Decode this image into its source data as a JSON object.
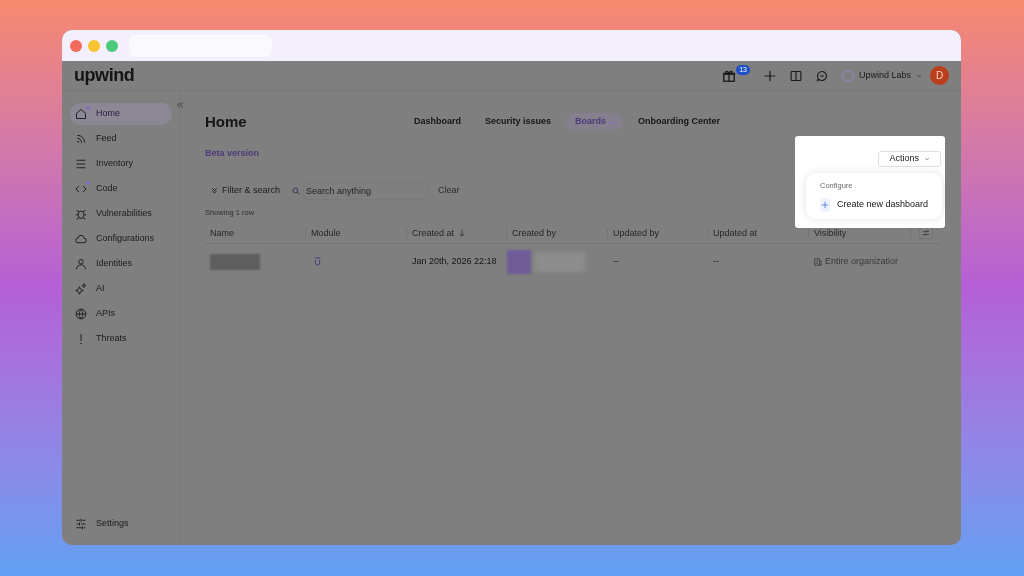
{
  "logo": "upwind",
  "header": {
    "notification_count": "13",
    "org": "Upwind Labs",
    "avatar": "D"
  },
  "sidebar": {
    "items": [
      {
        "label": "Home",
        "selected": true,
        "dot": true
      },
      {
        "label": "Feed",
        "selected": false,
        "dot": false
      },
      {
        "label": "Inventory",
        "selected": false,
        "dot": false
      },
      {
        "label": "Code",
        "selected": false,
        "dot": true
      },
      {
        "label": "Vulnerabilities",
        "selected": false,
        "dot": false
      },
      {
        "label": "Configurations",
        "selected": false,
        "dot": false
      },
      {
        "label": "Identities",
        "selected": false,
        "dot": false
      },
      {
        "label": "AI",
        "selected": false,
        "dot": false
      },
      {
        "label": "APIs",
        "selected": false,
        "dot": false
      },
      {
        "label": "Threats",
        "selected": false,
        "dot": false
      }
    ],
    "footer": {
      "label": "Settings"
    }
  },
  "page": {
    "title": "Home",
    "beta": "Beta version"
  },
  "tabs": [
    {
      "label": "Dashboard",
      "selected": false,
      "dot": false
    },
    {
      "label": "Security issues",
      "selected": false,
      "dot": false
    },
    {
      "label": "Boards",
      "selected": true,
      "dot": true
    },
    {
      "label": "Onboarding Center",
      "selected": false,
      "dot": false
    }
  ],
  "filter": {
    "toggle": "Filter & search",
    "placeholder": "Search anything",
    "clear": "Clear"
  },
  "table": {
    "count": "Showing 1 row",
    "columns": [
      {
        "label": "Name",
        "sorted": false
      },
      {
        "label": "Module",
        "sorted": false
      },
      {
        "label": "Created at",
        "sorted": true
      },
      {
        "label": "Created by",
        "sorted": false
      },
      {
        "label": "Updated by",
        "sorted": false
      },
      {
        "label": "Updated at",
        "sorted": false
      },
      {
        "label": "Visibility",
        "sorted": false
      }
    ],
    "rows": [
      {
        "created_at": "Jan 20th, 2026 22:18",
        "updated_by": "--",
        "updated_at": "--",
        "visibility": "Entire organizatior"
      }
    ]
  },
  "actions_menu": {
    "button": "Actions",
    "section": "Configure",
    "items": [
      "Create new dashboard"
    ]
  }
}
